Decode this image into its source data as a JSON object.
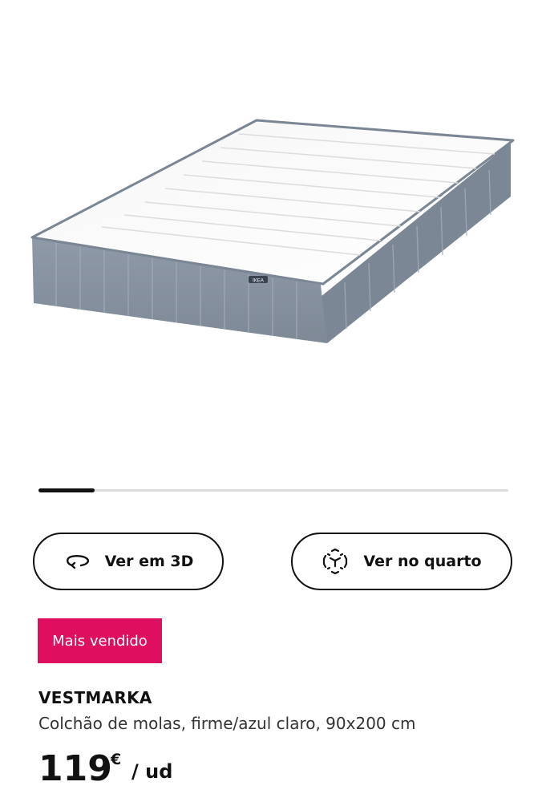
{
  "gallery": {
    "image_alt": "Colchão de molas VESTMARKA",
    "label_text": "IKEA",
    "progress": 0.12
  },
  "actions": {
    "view_3d_label": "Ver em 3D",
    "view_room_label": "Ver no quarto"
  },
  "badge": {
    "label": "Mais vendido",
    "color": "#dd0f5e"
  },
  "product": {
    "name": "VESTMARKA",
    "description": "Colchão de molas, firme/azul claro, 90x200 cm",
    "price_integer": "119",
    "price_currency": "€",
    "price_unit": "/ ud"
  }
}
